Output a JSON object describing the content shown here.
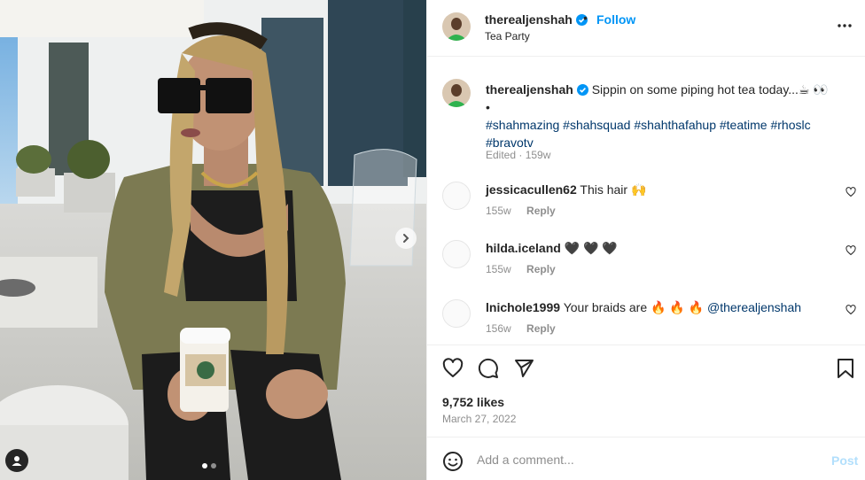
{
  "post": {
    "author": "therealjenshah",
    "separator": "•",
    "follow_label": "Follow",
    "location": "Tea Party",
    "caption_text": "Sippin on some piping hot tea today...☕ 👀",
    "caption_bullet": "•",
    "hashtags": "#shahmazing #shahsquad #shahthafahup #teatime #rhoslc #bravotv",
    "edited": "Edited · 159w",
    "likes": "9,752 likes",
    "date": "March 27, 2022"
  },
  "comments": [
    {
      "user": "jessicacullen62",
      "text": "This hair 🙌",
      "time": "155w",
      "reply": "Reply"
    },
    {
      "user": "hilda.iceland",
      "text": "🖤 🖤 🖤",
      "time": "155w",
      "reply": "Reply"
    },
    {
      "user": "lnichole1999",
      "text": "Your braids are 🔥 🔥 🔥 ",
      "mention": "@therealjenshah",
      "time": "156w",
      "reply": "Reply"
    }
  ],
  "composer": {
    "placeholder": "Add a comment...",
    "post_label": "Post"
  },
  "carousel": {
    "current": 1,
    "total": 2
  },
  "colors": {
    "link": "#0095f6",
    "hashtag": "#00376b",
    "muted": "#8e8e8e",
    "post_disabled": "#b2dffc"
  },
  "icons": [
    "verified-badge-icon",
    "more-options-icon",
    "heart-icon",
    "comment-icon",
    "share-icon",
    "bookmark-icon",
    "emoji-icon",
    "chevron-right-icon",
    "user-tag-icon"
  ]
}
